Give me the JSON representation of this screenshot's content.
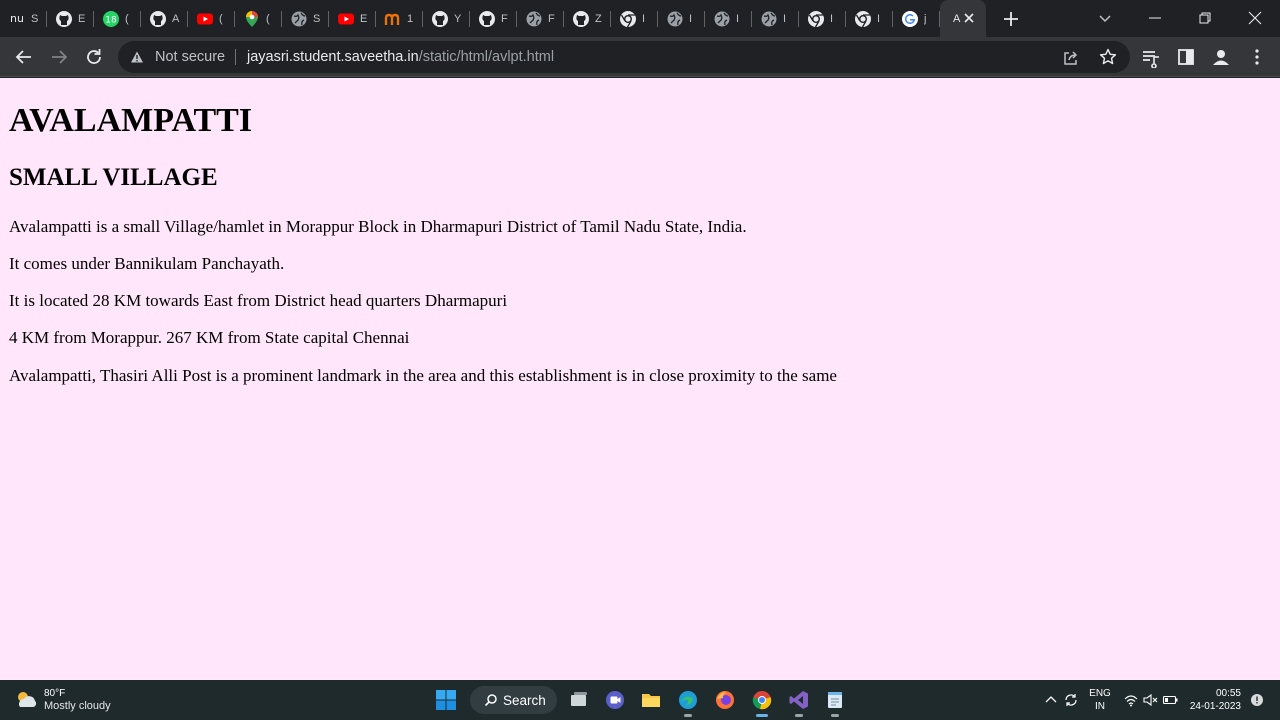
{
  "tabs": [
    {
      "label": "S",
      "icon": "app-icon"
    },
    {
      "label": "E",
      "icon": "github-icon"
    },
    {
      "label": "(",
      "icon": "whatsapp-icon"
    },
    {
      "label": "A",
      "icon": "github-icon"
    },
    {
      "label": "(",
      "icon": "youtube-icon"
    },
    {
      "label": "(",
      "icon": "google-maps-icon"
    },
    {
      "label": "S",
      "icon": "globe-icon"
    },
    {
      "label": "E",
      "icon": "youtube-icon"
    },
    {
      "label": "1",
      "icon": "app-icon"
    },
    {
      "label": "Y",
      "icon": "github-icon"
    },
    {
      "label": "F",
      "icon": "github-icon"
    },
    {
      "label": "F",
      "icon": "globe-icon"
    },
    {
      "label": "Z",
      "icon": "github-icon"
    },
    {
      "label": "I",
      "icon": "chrome-icon"
    },
    {
      "label": "I",
      "icon": "globe-icon"
    },
    {
      "label": "I",
      "icon": "globe-icon"
    },
    {
      "label": "I",
      "icon": "globe-icon"
    },
    {
      "label": "I",
      "icon": "chrome-icon"
    },
    {
      "label": "I",
      "icon": "chrome-icon"
    },
    {
      "label": "j",
      "icon": "google-icon"
    }
  ],
  "active_tab": {
    "label": "A"
  },
  "first_tab_prefix": "nu",
  "whatsapp_badge": "18",
  "omnibox": {
    "security_label": "Not secure",
    "url_host": "jayasri.student.saveetha.in",
    "url_path": "/static/html/avlpt.html"
  },
  "page": {
    "title": "AVALAMPATTI",
    "subtitle": "SMALL VILLAGE",
    "paragraphs": [
      "Avalampatti is a small Village/hamlet in Morappur Block in Dharmapuri District of Tamil Nadu State, India.",
      "It comes under Bannikulam Panchayath.",
      "It is located 28 KM towards East from District head quarters Dharmapuri",
      "4 KM from Morappur. 267 KM from State capital Chennai",
      "Avalampatti, Thasiri Alli Post is a prominent landmark in the area and this establishment is in close proximity to the same"
    ],
    "background_color": "#ffe6fa"
  },
  "taskbar": {
    "weather_temp": "80°F",
    "weather_desc": "Mostly cloudy",
    "search_label": "Search",
    "lang_line1": "ENG",
    "lang_line2": "IN",
    "time": "00:55",
    "date": "24-01-2023",
    "apps": [
      "task-view-icon",
      "teams-icon",
      "file-explorer-icon",
      "edge-icon",
      "firefox-icon",
      "chrome-icon",
      "visual-studio-icon",
      "notepad-icon"
    ]
  }
}
